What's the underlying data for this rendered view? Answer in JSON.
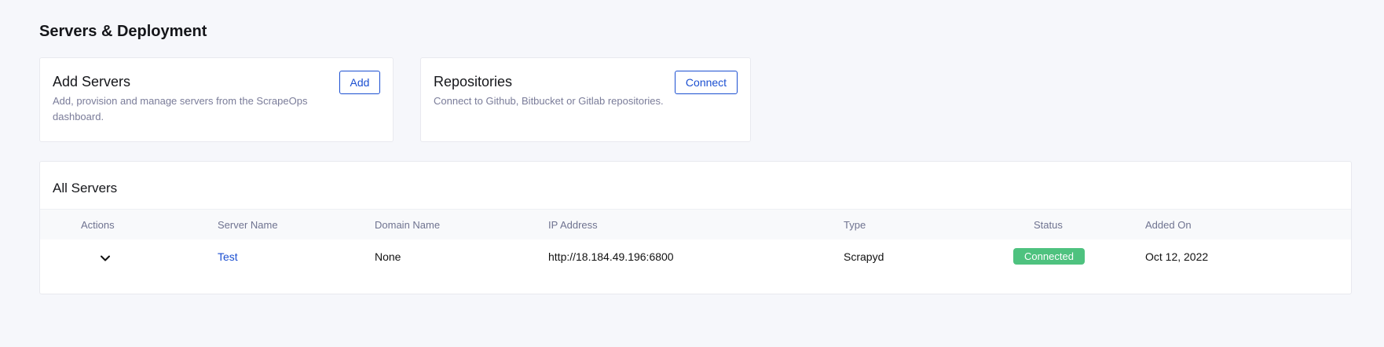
{
  "page": {
    "title": "Servers & Deployment"
  },
  "add_card": {
    "title": "Add Servers",
    "description": "Add, provision and manage servers from the ScrapeOps dashboard.",
    "button_label": "Add"
  },
  "repo_card": {
    "title": "Repositories",
    "description": "Connect to Github, Bitbucket or Gitlab repositories.",
    "button_label": "Connect"
  },
  "servers": {
    "title": "All Servers",
    "columns": [
      "Actions",
      "Server Name",
      "Domain Name",
      "IP Address",
      "Type",
      "Status",
      "Added On"
    ],
    "rows": [
      {
        "action_icon": "chevron-down-icon",
        "server_name": "Test",
        "domain_name": "None",
        "ip_address": "http://18.184.49.196:6800",
        "type": "Scrapyd",
        "status": "Connected",
        "added_on": "Oct 12, 2022"
      }
    ]
  },
  "colors": {
    "accent": "#1b4fd1",
    "status_connected": "#4ec27f",
    "muted_text": "#7a7c99",
    "background": "#f6f7fb"
  }
}
